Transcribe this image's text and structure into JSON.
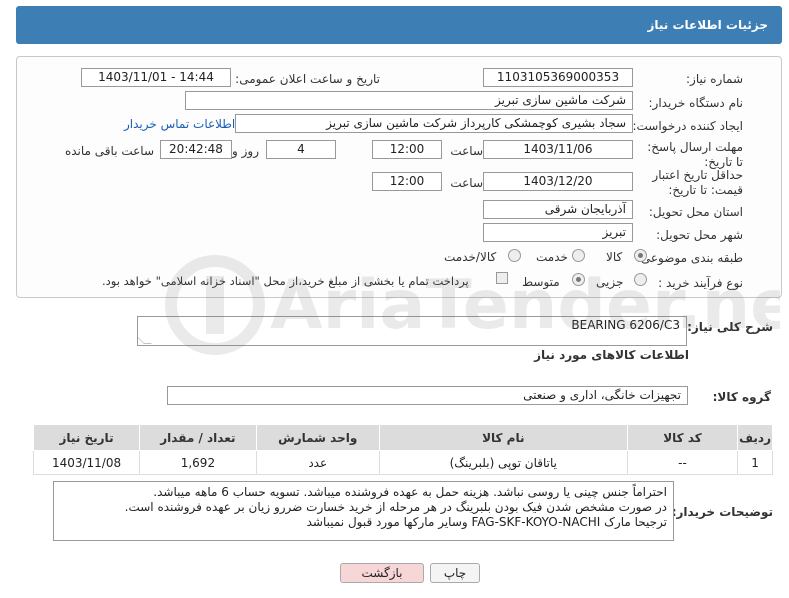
{
  "header": {
    "title": "جزئیات اطلاعات نیاز"
  },
  "fields": {
    "need_number_label": "شماره نیاز:",
    "need_number": "1103105369000353",
    "announce_label": "تاریخ و ساعت اعلان عمومی:",
    "announce_value": "1403/11/01 - 14:44",
    "buyer_org_label": "نام دستگاه خریدار:",
    "buyer_org": "شرکت ماشین سازی تبریز",
    "requester_label": "ایجاد کننده درخواست:",
    "requester": "سجاد بشیری کوچمشکی کارپرداز شرکت ماشین سازی تبریز",
    "contact_link": "اطلاعات تماس خریدار",
    "deadline_label": "مهلت ارسال پاسخ: تا تاریخ:",
    "deadline_date": "1403/11/06",
    "time_label": "ساعت",
    "deadline_time": "12:00",
    "days_value": "4",
    "days_label": "روز و",
    "remaining_time": "20:42:48",
    "remaining_label": "ساعت باقی مانده",
    "validity_label": "حداقل تاریخ اعتبار قیمت: تا تاریخ:",
    "validity_date": "1403/12/20",
    "validity_time": "12:00",
    "province_label": "استان محل تحویل:",
    "province": "آذربایجان شرقی",
    "city_label": "شهر محل تحویل:",
    "city": "تبریز",
    "category_label": "طبقه بندی موضوعی:",
    "category_options": [
      "کالا",
      "خدمت",
      "کالا/خدمت"
    ],
    "process_label": "نوع فرآیند خرید :",
    "process_options": [
      "جزیی",
      "متوسط"
    ],
    "payment_note": "پرداخت تمام یا بخشی از مبلغ خرید،از محل \"اسناد خزانه اسلامی\" خواهد بود."
  },
  "summary": {
    "label": "شرح کلی نیاز:",
    "value": "BEARING 6206/C3"
  },
  "goods": {
    "section_title": "اطلاعات کالاهای مورد نیاز",
    "group_label": "گروه کالا:",
    "group_value": "تجهیزات خانگی، اداری و صنعتی",
    "columns": [
      "ردیف",
      "کد کالا",
      "نام کالا",
      "واحد شمارش",
      "تعداد / مقدار",
      "تاریخ نیاز"
    ],
    "rows": [
      [
        "1",
        "--",
        "یاتاقان توپی (بلبرینگ)",
        "عدد",
        "1,692",
        "1403/11/08"
      ]
    ]
  },
  "buyer_notes": {
    "label": "توضیحات خریدار:",
    "lines": [
      "احتراماً جنس چینی یا روسی نباشد.    هزینه حمل به عهده فروشنده میباشد. تسویه حساب 6 ماهه میباشد.",
      "در صورت مشخص شدن فیک بودن بلبرینگ در هر مرحله از خرید خسارت ضررو زیان بر عهده  فروشنده است.",
      "ترجیحا مارک FAG-SKF-KOYO-NACHI وسایر مارکها مورد قبول نمیباشد"
    ]
  },
  "buttons": {
    "print": "چاپ",
    "back": "بازگشت"
  },
  "watermark": {
    "text": "AriaTender.neT"
  },
  "colors": {
    "header_bg": "#3d7fb5",
    "link": "#1a5fb4",
    "back_btn_bg": "#f6d6d6"
  }
}
